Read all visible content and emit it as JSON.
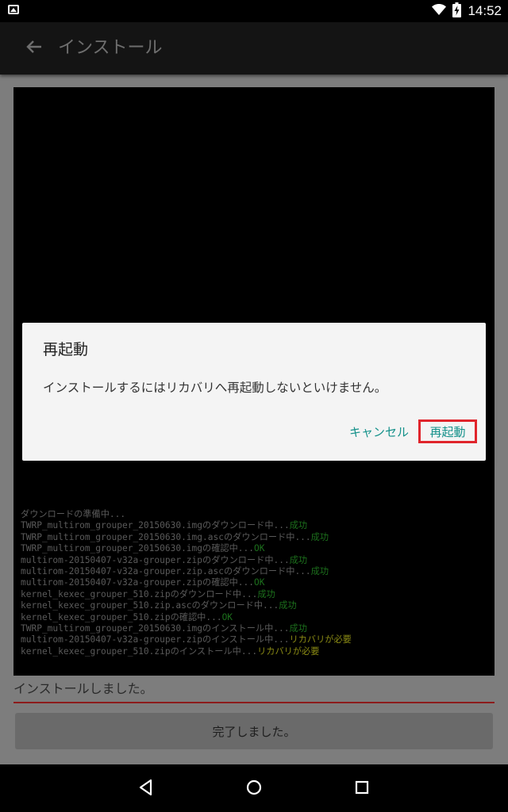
{
  "status_bar": {
    "time": "14:52",
    "icons": [
      "image-icon",
      "wifi-icon",
      "battery-charging-icon"
    ]
  },
  "app_bar": {
    "title": "インストール",
    "back_icon": "arrow-left-icon"
  },
  "console": {
    "log_lines": [
      [
        {
          "text": "ダウンロードの準備中...",
          "style": "normal"
        }
      ],
      [
        {
          "text": "TWRP_multirom_grouper_20150630.imgのダウンロード中...",
          "style": "normal"
        },
        {
          "text": "成功",
          "style": "ok"
        }
      ],
      [
        {
          "text": "TWRP_multirom_grouper_20150630.img.ascのダウンロード中...",
          "style": "normal"
        },
        {
          "text": "成功",
          "style": "ok"
        }
      ],
      [
        {
          "text": "TWRP_multirom_grouper_20150630.imgの確認中...",
          "style": "normal"
        },
        {
          "text": "OK",
          "style": "ok"
        }
      ],
      [
        {
          "text": "multirom-20150407-v32a-grouper.zipのダウンロード中...",
          "style": "normal"
        },
        {
          "text": "成功",
          "style": "ok"
        }
      ],
      [
        {
          "text": "multirom-20150407-v32a-grouper.zip.ascのダウンロード中...",
          "style": "normal"
        },
        {
          "text": "成功",
          "style": "ok"
        }
      ],
      [
        {
          "text": "multirom-20150407-v32a-grouper.zipの確認中...",
          "style": "normal"
        },
        {
          "text": "OK",
          "style": "ok"
        }
      ],
      [
        {
          "text": "kernel_kexec_grouper_510.zipのダウンロード中...",
          "style": "normal"
        },
        {
          "text": "成功",
          "style": "ok"
        }
      ],
      [
        {
          "text": "kernel_kexec_grouper_510.zip.ascのダウンロード中...",
          "style": "normal"
        },
        {
          "text": "成功",
          "style": "ok"
        }
      ],
      [
        {
          "text": "kernel_kexec_grouper_510.zipの確認中...",
          "style": "normal"
        },
        {
          "text": "OK",
          "style": "ok"
        }
      ],
      [
        {
          "text": "TWRP_multirom_grouper_20150630.imgのインストール中...",
          "style": "normal"
        },
        {
          "text": "成功",
          "style": "ok"
        }
      ],
      [
        {
          "text": "multirom-20150407-v32a-grouper.zipのインストール中...",
          "style": "normal"
        },
        {
          "text": "リカバリが必要",
          "style": "warn"
        }
      ],
      [
        {
          "text": "kernel_kexec_grouper_510.zipのインストール中...",
          "style": "normal"
        },
        {
          "text": "リカバリが必要",
          "style": "warn"
        }
      ]
    ]
  },
  "result": {
    "status_text": "インストールしました。",
    "done_button_label": "完了しました。"
  },
  "dialog": {
    "title": "再起動",
    "message": "インストールするにはリカバリへ再起動しないといけません。",
    "cancel_label": "キャンセル",
    "restart_label": "再起動"
  },
  "nav_bar": {
    "icons": [
      "back-triangle-icon",
      "home-circle-icon",
      "recents-square-icon"
    ]
  },
  "colors": {
    "accent": "#14918a",
    "highlight_box": "#e0252c",
    "log_ok": "#1c6f1c",
    "log_warn": "#8a8a14"
  }
}
